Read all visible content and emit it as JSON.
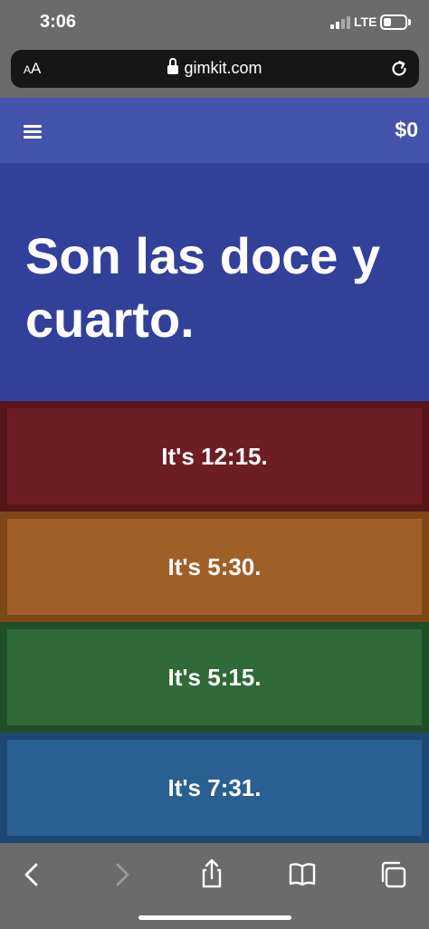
{
  "status_bar": {
    "time": "3:06",
    "network": "LTE",
    "icons": [
      "signal-icon",
      "battery-icon"
    ]
  },
  "browser": {
    "text_size_label_small": "A",
    "text_size_label_large": "A",
    "url": "gimkit.com",
    "icons": [
      "lock-icon",
      "reload-icon"
    ]
  },
  "app_header": {
    "money": "$0",
    "icons": [
      "menu-icon"
    ]
  },
  "question": {
    "text": "Son las doce y cuarto."
  },
  "answers": [
    {
      "label": "It's 12:15.",
      "color": "#6d1e24",
      "border_color": "#551519"
    },
    {
      "label": "It's 5:30.",
      "color": "#a15f28",
      "border_color": "#7e4716"
    },
    {
      "label": "It's 5:15.",
      "color": "#306a3a",
      "border_color": "#1f4e28"
    },
    {
      "label": "It's 7:31.",
      "color": "#2a5f91",
      "border_color": "#1d4873"
    }
  ],
  "colors": {
    "header": "#4453ab",
    "question_background": "#33409a",
    "browser_chrome": "#6b6b6b"
  },
  "toolbar": {
    "icons": [
      "back-icon",
      "forward-icon",
      "share-icon",
      "bookmarks-icon",
      "tabs-icon"
    ]
  }
}
